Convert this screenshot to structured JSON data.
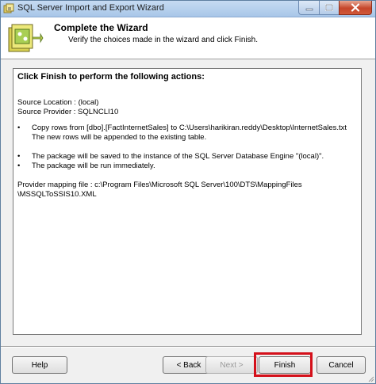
{
  "window": {
    "title": "SQL Server Import and Export Wizard"
  },
  "header": {
    "title": "Complete the Wizard",
    "subtitle": "Verify the choices made in the wizard and click Finish."
  },
  "content": {
    "heading": "Click Finish to perform the following actions:",
    "source_location": "Source Location : (local)",
    "source_provider": "Source Provider : SQLNCLI10",
    "bullet_1": "Copy rows from [dbo].[FactInternetSales] to C:\\Users\\harikiran.reddy\\Desktop\\InternetSales.txt",
    "bullet_1_sub": "The new rows will be appended to the existing table.",
    "bullet_2": "The package will be saved to the instance of the SQL Server Database Engine \"(local)\".",
    "bullet_3": "The package will be run immediately.",
    "mapping_line_1": "Provider mapping file : c:\\Program Files\\Microsoft SQL Server\\100\\DTS\\MappingFiles",
    "mapping_line_2": "\\MSSQLToSSIS10.XML",
    "bullet_symbol": "•"
  },
  "buttons": {
    "help": "Help",
    "back": "< Back",
    "next": "Next >",
    "finish": "Finish",
    "cancel": "Cancel"
  },
  "colors": {
    "highlight": "#d4101a",
    "title_bar": "#b5cfee",
    "close_button": "#c5462b"
  },
  "icons": {
    "app": "wizard-app-icon",
    "header": "wizard-graphic-icon",
    "minimize": "minimize-icon",
    "maximize": "maximize-icon",
    "close": "close-icon",
    "grip": "resize-grip-icon"
  }
}
